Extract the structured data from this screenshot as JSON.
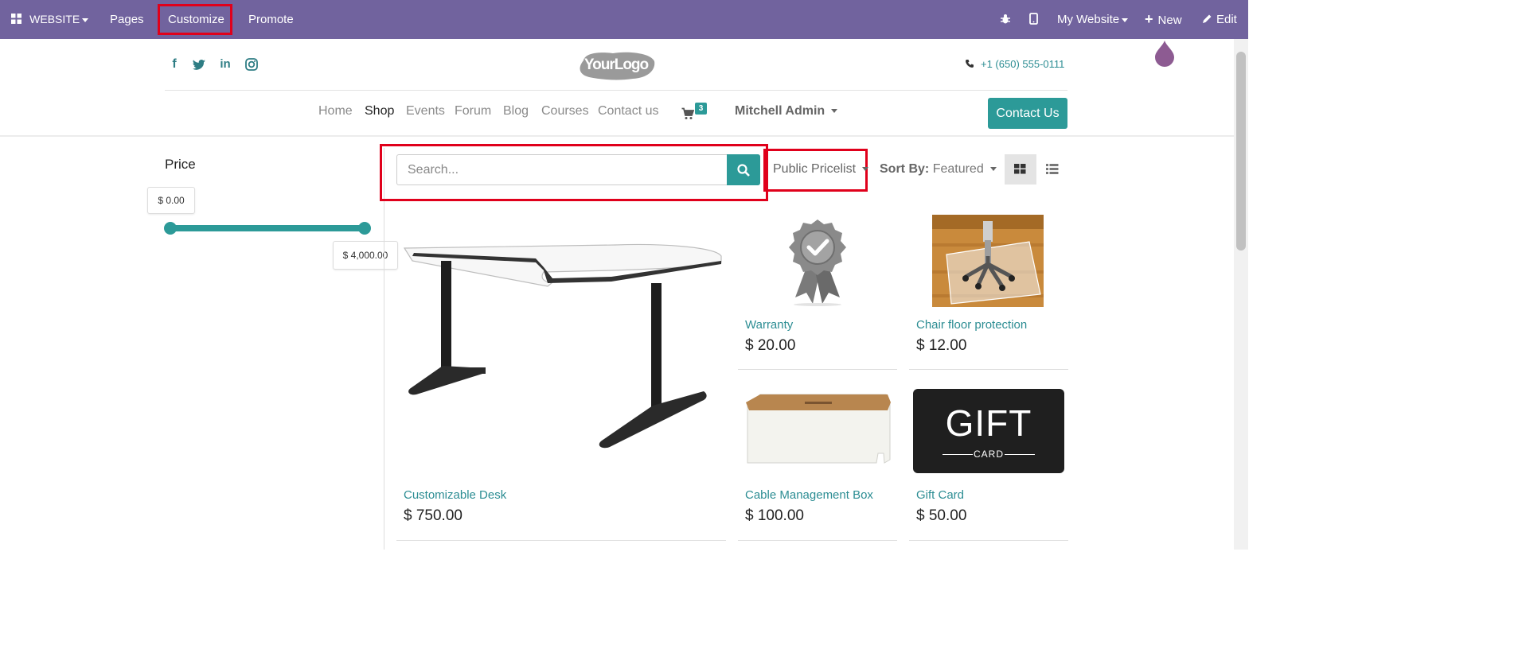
{
  "topbar": {
    "app_label": "WEBSITE",
    "items": [
      "Pages",
      "Customize",
      "Promote"
    ],
    "site_label": "My Website",
    "new_label": "New",
    "edit_label": "Edit"
  },
  "header": {
    "logo_text": "YourLogo",
    "phone": "+1 (650) 555-0111",
    "social": [
      "facebook-icon",
      "twitter-icon",
      "linkedin-icon",
      "instagram-icon"
    ]
  },
  "nav": {
    "items": [
      "Home",
      "Shop",
      "Events",
      "Forum",
      "Blog",
      "Courses",
      "Contact us"
    ],
    "active": "Shop",
    "cart_count": "3",
    "user": "Mitchell Admin",
    "cta": "Contact Us"
  },
  "filters": {
    "price_title": "Price",
    "min_label": "$ 0.00",
    "max_label": "$ 4,000.00",
    "range_min_fraction": 0.0,
    "range_max_fraction": 1.0
  },
  "toolbar": {
    "search_placeholder": "Search...",
    "pricelist": "Public Pricelist",
    "sort_label": "Sort By:",
    "sort_value": "Featured"
  },
  "products": [
    {
      "name": "Customizable Desk",
      "price": "$ 750.00"
    },
    {
      "name": "Warranty",
      "price": "$ 20.00"
    },
    {
      "name": "Chair floor protection",
      "price": "$ 12.00"
    },
    {
      "name": "Cable Management Box",
      "price": "$ 100.00"
    },
    {
      "name": "Gift Card",
      "price": "$ 50.00"
    }
  ],
  "giftcard": {
    "big": "GIFT",
    "small": "CARD"
  },
  "colors": {
    "topbar": "#71639e",
    "accent": "#2c9a98",
    "link": "#2c8d93",
    "highlight": "#e0001b"
  }
}
